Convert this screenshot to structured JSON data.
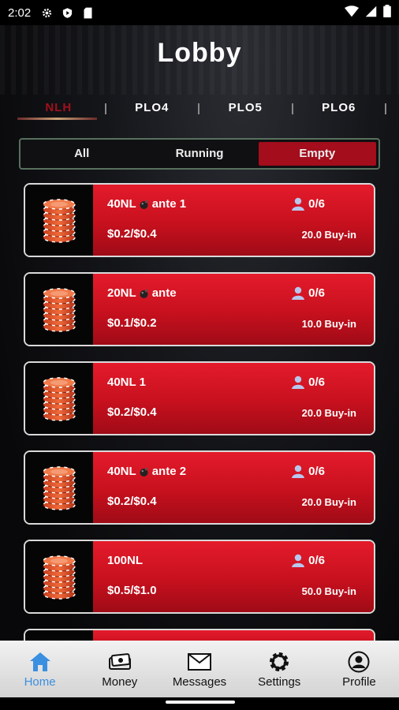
{
  "status_bar": {
    "time": "2:02"
  },
  "header": {
    "title": "Lobby"
  },
  "game_tabs": [
    {
      "label": "NLH",
      "active": true
    },
    {
      "label": "PLO4",
      "active": false
    },
    {
      "label": "PLO5",
      "active": false
    },
    {
      "label": "PLO6",
      "active": false
    }
  ],
  "filters": [
    {
      "label": "All",
      "active": false
    },
    {
      "label": "Running",
      "active": false
    },
    {
      "label": "Empty",
      "active": true
    }
  ],
  "tables": [
    {
      "name": "40NL",
      "suffix": "ante 1",
      "bomb": true,
      "blinds": "$0.2/$0.4",
      "players": "0/6",
      "buyin": "20.0 Buy-in"
    },
    {
      "name": "20NL",
      "suffix": "ante",
      "bomb": true,
      "blinds": "$0.1/$0.2",
      "players": "0/6",
      "buyin": "10.0 Buy-in"
    },
    {
      "name": "40NL 1",
      "suffix": "",
      "bomb": false,
      "blinds": "$0.2/$0.4",
      "players": "0/6",
      "buyin": "20.0 Buy-in"
    },
    {
      "name": "40NL",
      "suffix": "ante 2",
      "bomb": true,
      "blinds": "$0.2/$0.4",
      "players": "0/6",
      "buyin": "20.0 Buy-in"
    },
    {
      "name": "100NL",
      "suffix": "",
      "bomb": false,
      "blinds": "$0.5/$1.0",
      "players": "0/6",
      "buyin": "50.0 Buy-in"
    }
  ],
  "bottom_nav": [
    {
      "label": "Home",
      "icon": "home-icon",
      "active": true
    },
    {
      "label": "Money",
      "icon": "money-icon",
      "active": false
    },
    {
      "label": "Messages",
      "icon": "envelope-icon",
      "active": false
    },
    {
      "label": "Settings",
      "icon": "gear-icon",
      "active": false
    },
    {
      "label": "Profile",
      "icon": "profile-icon",
      "active": false
    }
  ],
  "colors": {
    "accent_red": "#c7101e",
    "active_tab": "#a0101c",
    "nav_active": "#3b8fe0"
  }
}
